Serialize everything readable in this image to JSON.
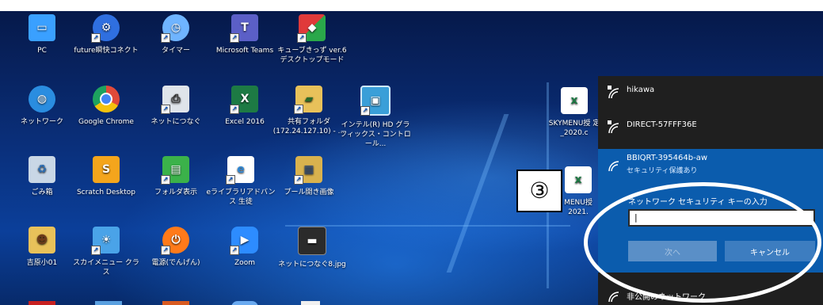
{
  "caption": "",
  "desktop": {
    "row1": [
      {
        "label": "PC",
        "icon": "pc-icon",
        "color": "#3aa0ff"
      },
      {
        "label": "future瞬快コネクト",
        "icon": "network-gear-icon",
        "color": "#2f6fe0"
      },
      {
        "label": "タイマー",
        "icon": "timer-icon",
        "color": "#6fb4ff"
      },
      {
        "label": "Microsoft Teams",
        "icon": "teams-icon",
        "color": "#5b5fc7"
      },
      {
        "label": "キューブきっず ver.6 デスクトップモード",
        "icon": "cube-icon",
        "color": "#e03a3a"
      }
    ],
    "row2": [
      {
        "label": "ネットワーク",
        "icon": "globe-icon",
        "color": "#2a8de0"
      },
      {
        "label": "Google Chrome",
        "icon": "chrome-icon",
        "color": "#e04a3a"
      },
      {
        "label": "ネットにつなぐ",
        "icon": "printer-icon",
        "color": "#dfe4ea"
      },
      {
        "label": "Excel 2016",
        "icon": "excel-icon",
        "color": "#1d7a44"
      },
      {
        "label": "共有フォルダ (172.24.127.10) - ...",
        "icon": "shared-folder-icon",
        "color": "#e8c15a"
      },
      {
        "label": "インテル(R) HD グラフィックス・コントロール...",
        "icon": "intel-icon",
        "color": "#3a9fd8"
      }
    ],
    "row3": [
      {
        "label": "ごみ箱",
        "icon": "recycle-bin-icon",
        "color": "#c9d7e6"
      },
      {
        "label": "Scratch Desktop",
        "icon": "scratch-icon",
        "color": "#f4a51c"
      },
      {
        "label": "フォルダ表示",
        "icon": "folder-view-icon",
        "color": "#3bb24a"
      },
      {
        "label": "eライブラリアドバンス 生徒",
        "icon": "elibrary-icon",
        "color": "#2f88d6"
      },
      {
        "label": "プール開き画像",
        "icon": "image-folder-icon",
        "color": "#d9b24e"
      }
    ],
    "row4": [
      {
        "label": "吉原小01",
        "icon": "user-folder-icon",
        "color": "#e8c15a"
      },
      {
        "label": "スカイメニュー クラス",
        "icon": "skymenu-icon",
        "color": "#4aa3e8"
      },
      {
        "label": "電源(でんげん)",
        "icon": "power-icon",
        "color": "#ff7a1a"
      },
      {
        "label": "Zoom",
        "icon": "zoom-icon",
        "color": "#2d8cff"
      },
      {
        "label": "ネットにつなぐ8.jpg",
        "icon": "jpg-file-icon",
        "color": "#2b2b2b"
      }
    ],
    "right_files": [
      {
        "label": "SKYMENU授 定_2020.c",
        "icon": "excel-file-icon"
      },
      {
        "label": "MENU授 2021.",
        "icon": "excel-file-icon"
      }
    ]
  },
  "wifi_panel": {
    "networks": [
      {
        "name": "hikawa",
        "secured": true
      },
      {
        "name": "DIRECT-57FFF36E",
        "secured": true
      }
    ],
    "selected": {
      "name": "BBIQRT-395464b-aw",
      "status": "セキュリティ保護あり",
      "key_label": "ネットワーク セキュリティ キーの入力",
      "key_value": "|",
      "next_button": "次へ",
      "cancel_button": "キャンセル"
    },
    "other_network": "非公開のネットワーク"
  },
  "annotation": {
    "step_label": "③"
  },
  "colors": {
    "panel_bg": "#1f1f1f",
    "selected_bg": "#0b5cad",
    "button_cancel": "#3d7dc0",
    "button_next_disabled": "#5a8fc7"
  }
}
